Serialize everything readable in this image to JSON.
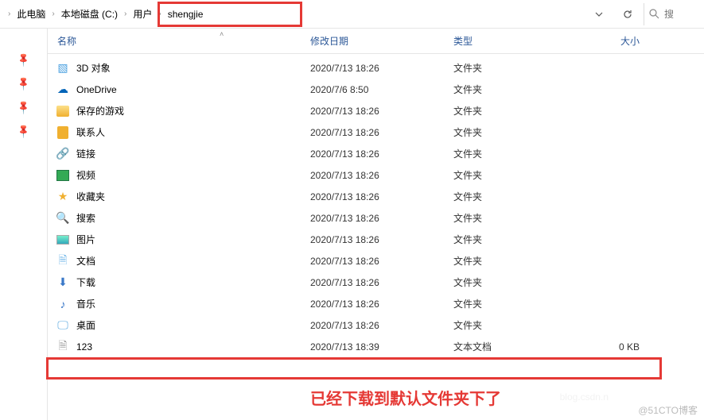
{
  "breadcrumb": {
    "items": [
      "此电脑",
      "本地磁盘 (C:)",
      "用户",
      "shengjie"
    ]
  },
  "search": {
    "placeholder": "搜"
  },
  "columns": {
    "name": "名称",
    "date": "修改日期",
    "type": "类型",
    "size": "大小"
  },
  "files": [
    {
      "icon": "3d",
      "name": "3D 对象",
      "date": "2020/7/13 18:26",
      "type": "文件夹",
      "size": ""
    },
    {
      "icon": "onedrive",
      "name": "OneDrive",
      "date": "2020/7/6 8:50",
      "type": "文件夹",
      "size": ""
    },
    {
      "icon": "games",
      "name": "保存的游戏",
      "date": "2020/7/13 18:26",
      "type": "文件夹",
      "size": ""
    },
    {
      "icon": "contacts",
      "name": "联系人",
      "date": "2020/7/13 18:26",
      "type": "文件夹",
      "size": ""
    },
    {
      "icon": "links",
      "name": "链接",
      "date": "2020/7/13 18:26",
      "type": "文件夹",
      "size": ""
    },
    {
      "icon": "videos",
      "name": "视频",
      "date": "2020/7/13 18:26",
      "type": "文件夹",
      "size": ""
    },
    {
      "icon": "favorites",
      "name": "收藏夹",
      "date": "2020/7/13 18:26",
      "type": "文件夹",
      "size": ""
    },
    {
      "icon": "search",
      "name": "搜索",
      "date": "2020/7/13 18:26",
      "type": "文件夹",
      "size": ""
    },
    {
      "icon": "pictures",
      "name": "图片",
      "date": "2020/7/13 18:26",
      "type": "文件夹",
      "size": ""
    },
    {
      "icon": "documents",
      "name": "文档",
      "date": "2020/7/13 18:26",
      "type": "文件夹",
      "size": ""
    },
    {
      "icon": "downloads",
      "name": "下载",
      "date": "2020/7/13 18:26",
      "type": "文件夹",
      "size": ""
    },
    {
      "icon": "music",
      "name": "音乐",
      "date": "2020/7/13 18:26",
      "type": "文件夹",
      "size": ""
    },
    {
      "icon": "desktop",
      "name": "桌面",
      "date": "2020/7/13 18:26",
      "type": "文件夹",
      "size": ""
    },
    {
      "icon": "text",
      "name": "123",
      "date": "2020/7/13 18:39",
      "type": "文本文档",
      "size": "0 KB"
    }
  ],
  "annotation": "已经下载到默认文件夹下了",
  "watermark": "@51CTO博客",
  "watermark2": "blog.csdn.n"
}
